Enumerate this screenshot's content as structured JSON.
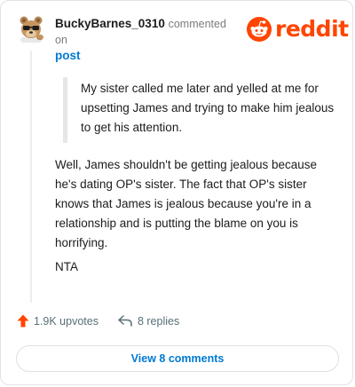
{
  "comment": {
    "username": "BuckyBarnes_0310",
    "action_text": "commented on",
    "target_text": "post",
    "quote": "My sister called me later and yelled at me for upsetting James and trying to make him jealous to get his attention.",
    "body": "Well, James shouldn't be getting jealous because he's dating OP's sister. The fact that OP's sister knows that James is jealous because you're in a relationship and is putting the blame on you is horrifying.",
    "verdict": "NTA"
  },
  "brand": {
    "name": "reddit",
    "color": "#ff4500"
  },
  "actions": {
    "upvotes_label": "1.9K upvotes",
    "replies_label": "8 replies",
    "upvote_icon": "upvote-arrow-icon",
    "reply_icon": "reply-arrow-icon"
  },
  "footer": {
    "view_comments_label": "View 8 comments"
  },
  "colors": {
    "link_blue": "#0079d3",
    "upvote_orange": "#ff4500",
    "muted_text": "#576f76"
  }
}
